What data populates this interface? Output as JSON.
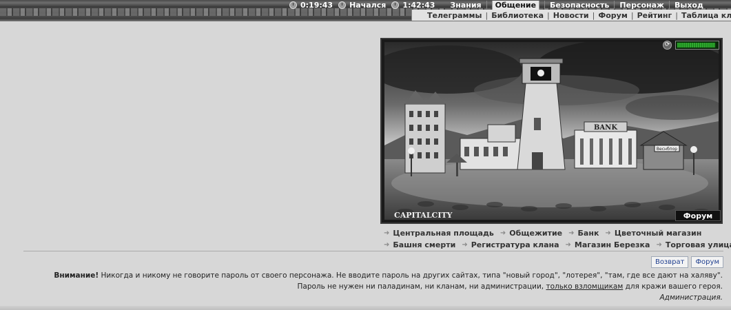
{
  "topbar": {
    "clock1": "0:19:43",
    "started_label": "Начался",
    "clock2": "1:42:43",
    "menu": [
      "Знания",
      "Общение",
      "Безопасность",
      "Персонаж",
      "Выход"
    ],
    "selected_menu": "Общение",
    "submenu": [
      "Телеграммы",
      "Библиотека",
      "Новости",
      "Форум",
      "Рейтинг",
      "Таблица кланов"
    ],
    "separator": "|"
  },
  "scene": {
    "bank_sign": "BANK",
    "shop_sign": "Веснбпор",
    "city_name": "CAPITALCITY",
    "forum_label": "Форум",
    "hp_level": 0.95
  },
  "locations": {
    "row1": [
      "Центральная площадь",
      "Общежитие",
      "Банк",
      "Цветочный магазин"
    ],
    "row2": [
      "Башня смерти",
      "Регистратура клана",
      "Магазин Березка",
      "Торговая улица"
    ]
  },
  "buttons": {
    "back": "Возврат",
    "forum": "Форум"
  },
  "notice": {
    "warning": "Внимание!",
    "line1": " Никогда и никому не говорите пароль от своего персонажа. Не вводите пароль на других сайтах, типа \"новый город\", \"лотерея\", \"там, где все дают на халяву\".",
    "line2_a": "Пароль не нужен ни паладинам, ни кланам, ни администрации, ",
    "line2_link": "только взломщикам",
    "line2_b": " для кражи вашего героя.",
    "signature": "Администрация."
  },
  "colors": {
    "background": "#d7d7d7",
    "hp": "#2ea82e",
    "button_text": "#1f3f8f"
  }
}
